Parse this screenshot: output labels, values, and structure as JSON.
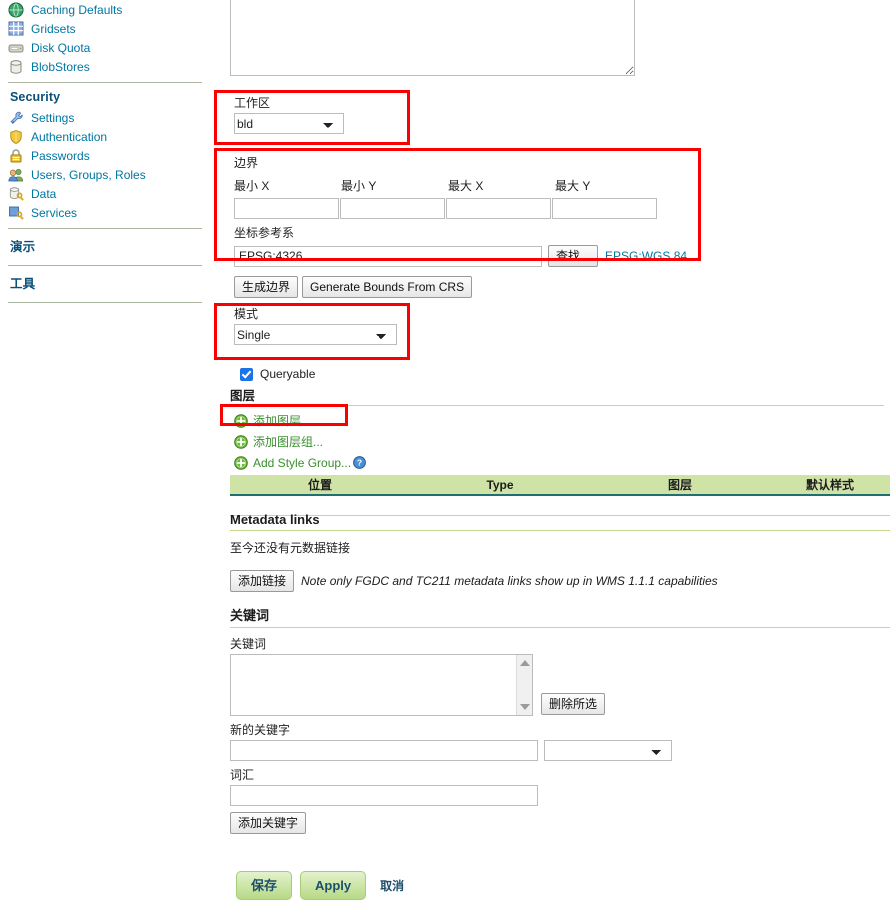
{
  "sidebar": {
    "top_items": [
      {
        "label": "Caching Defaults",
        "icon": "globe-icon"
      },
      {
        "label": "Gridsets",
        "icon": "grid-icon"
      },
      {
        "label": "Disk Quota",
        "icon": "disk-icon"
      },
      {
        "label": "BlobStores",
        "icon": "database-icon"
      }
    ],
    "security_heading": "Security",
    "security_items": [
      {
        "label": "Settings",
        "icon": "wrench-icon"
      },
      {
        "label": "Authentication",
        "icon": "shield-icon"
      },
      {
        "label": "Passwords",
        "icon": "lock-icon"
      },
      {
        "label": "Users, Groups, Roles",
        "icon": "users-icon"
      },
      {
        "label": "Data",
        "icon": "data-key-icon"
      },
      {
        "label": "Services",
        "icon": "services-key-icon"
      }
    ],
    "demo_heading": "演示",
    "tools_heading": "工具"
  },
  "main": {
    "abstract": {
      "value": "",
      "placeholder": ""
    },
    "workspace": {
      "label": "工作区",
      "selected": "bld",
      "options": [
        "bld"
      ]
    },
    "bounds": {
      "label": "边界",
      "min_x_label": "最小 X",
      "min_y_label": "最小 Y",
      "max_x_label": "最大 X",
      "max_y_label": "最大 Y",
      "min_x": "",
      "min_y": "",
      "max_x": "",
      "max_y": "",
      "crs_label": "坐标参考系",
      "crs_value": "EPSG:4326",
      "find_button": "查找...",
      "crs_link": "EPSG:WGS 84..."
    },
    "generate_bounds_button": "生成边界",
    "generate_bounds_from_crs_button": "Generate Bounds From CRS",
    "mode": {
      "label": "模式",
      "selected": "Single",
      "options": [
        "Single"
      ]
    },
    "queryable": {
      "label": "Queryable",
      "checked": true
    },
    "layers": {
      "heading": "图层",
      "add_layer": "添加图层...",
      "add_layer_group": "添加图层组...",
      "add_style_group": "Add Style Group...",
      "columns": [
        "位置",
        "Type",
        "图层",
        "默认样式"
      ]
    },
    "metadata": {
      "heading": "Metadata links",
      "empty_text": "至今还没有元数据链接",
      "add_link_button": "添加链接",
      "note": "Note only FGDC and TC211 metadata links show up in WMS 1.1.1 capabilities"
    },
    "keywords": {
      "heading": "关键词",
      "list_label": "关键词",
      "list_items": [],
      "remove_button": "删除所选",
      "new_keyword_label": "新的关键字",
      "new_keyword_value": "",
      "lang_selected": "",
      "vocabulary_label": "词汇",
      "vocabulary_value": "",
      "add_keyword_button": "添加关键字"
    },
    "actions": {
      "save": "保存",
      "apply": "Apply",
      "cancel": "取消"
    }
  },
  "colors": {
    "link": "#0076a3",
    "add_link": "#3a8f2f",
    "table_header_bg": "#cfe3a6",
    "table_header_rule": "#1f6f72",
    "annotation": "#fb0000",
    "button_green": "#b7d986"
  }
}
